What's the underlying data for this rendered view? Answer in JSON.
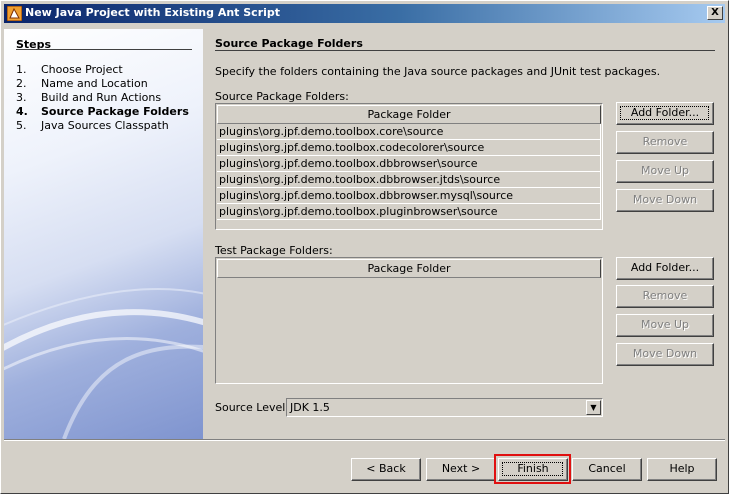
{
  "window": {
    "title": "New Java Project with Existing Ant Script",
    "close_glyph": "X"
  },
  "steps": {
    "title": "Steps",
    "items": [
      {
        "num": "1.",
        "label": "Choose Project"
      },
      {
        "num": "2.",
        "label": "Name and Location"
      },
      {
        "num": "3.",
        "label": "Build and Run Actions"
      },
      {
        "num": "4.",
        "label": "Source Package Folders"
      },
      {
        "num": "5.",
        "label": "Java Sources Classpath"
      }
    ],
    "current_index": 3
  },
  "main": {
    "section_title": "Source Package Folders",
    "description": "Specify the folders containing the Java source packages and JUnit test packages.",
    "source_label": "Source Package Folders:",
    "source_table": {
      "column_header": "Package Folder",
      "rows": [
        "plugins\\org.jpf.demo.toolbox.core\\source",
        "plugins\\org.jpf.demo.toolbox.codecolorer\\source",
        "plugins\\org.jpf.demo.toolbox.dbbrowser\\source",
        "plugins\\org.jpf.demo.toolbox.dbbrowser.jtds\\source",
        "plugins\\org.jpf.demo.toolbox.dbbrowser.mysql\\source",
        "plugins\\org.jpf.demo.toolbox.pluginbrowser\\source"
      ]
    },
    "source_buttons": {
      "add": "Add Folder...",
      "remove": "Remove",
      "move_up": "Move Up",
      "move_down": "Move Down"
    },
    "test_label": "Test Package Folders:",
    "test_table": {
      "column_header": "Package Folder",
      "rows": []
    },
    "test_buttons": {
      "add": "Add Folder...",
      "remove": "Remove",
      "move_up": "Move Up",
      "move_down": "Move Down"
    },
    "source_level_label": "Source Level:",
    "source_level_value": "JDK 1.5"
  },
  "footer": {
    "back": "< Back",
    "next": "Next >",
    "finish": "Finish",
    "cancel": "Cancel",
    "help": "Help"
  },
  "colors": {
    "highlight": "#e01010",
    "titlebar_start": "#0a246a",
    "titlebar_end": "#a6caf0"
  }
}
